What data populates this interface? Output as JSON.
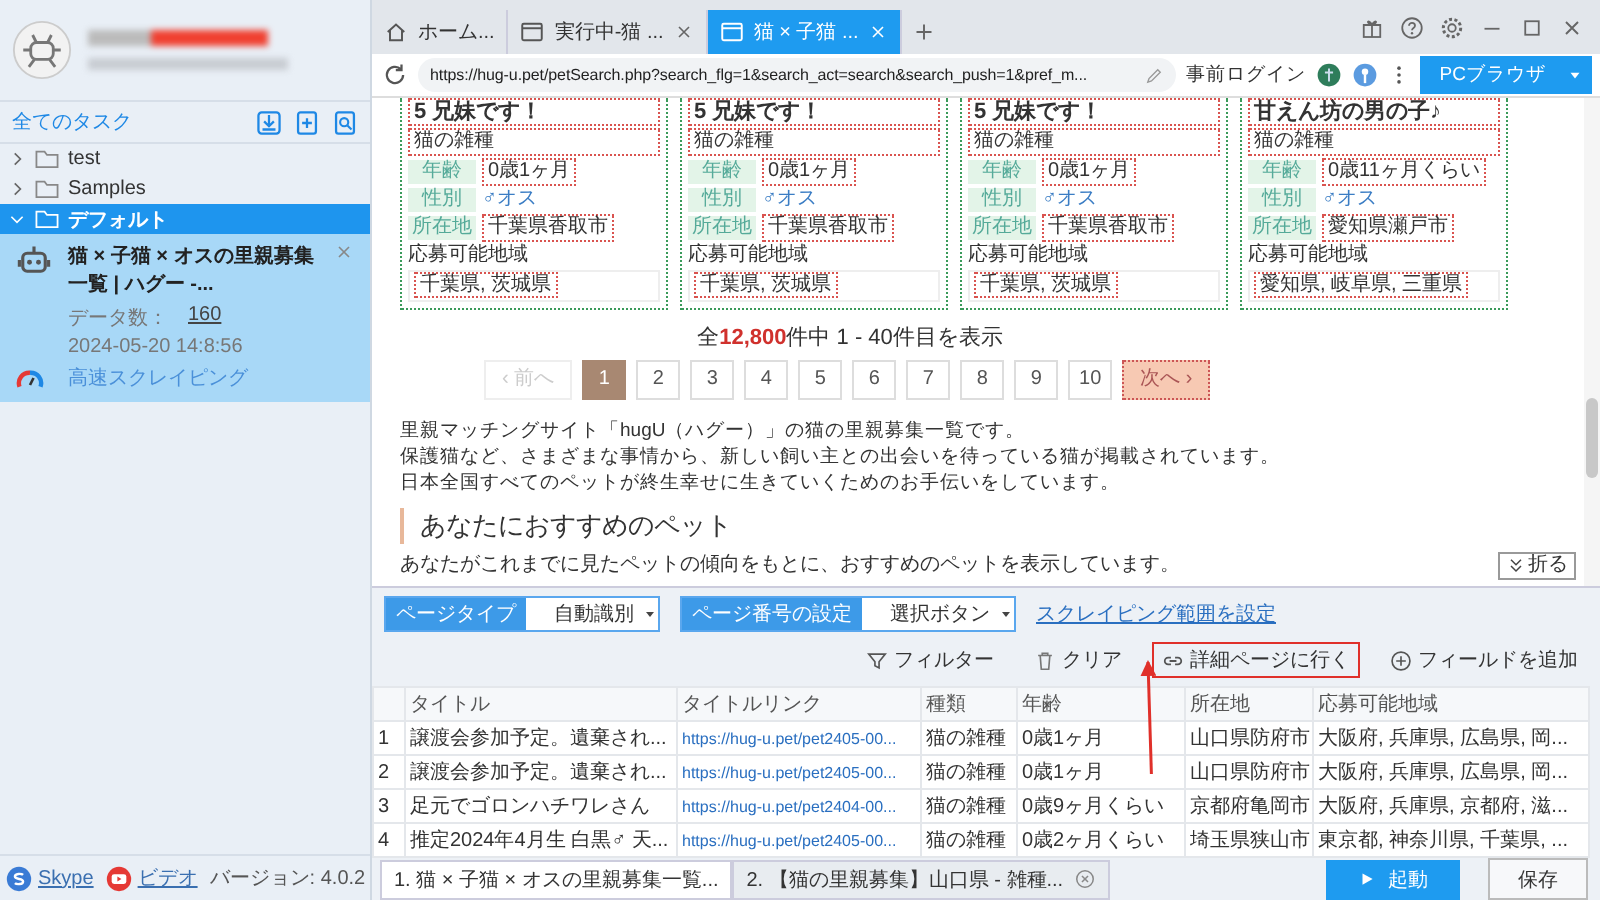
{
  "sidebar": {
    "heading": "全てのタスク",
    "folders": [
      {
        "name": "test",
        "expanded": false,
        "selected": false
      },
      {
        "name": "Samples",
        "expanded": false,
        "selected": false
      },
      {
        "name": "デフォルト",
        "expanded": true,
        "selected": true,
        "tasks": [
          {
            "title": "猫 × 子猫 × オスの里親募集一覧 | ハグー -...",
            "count_label": "データ数：",
            "count": "160",
            "timestamp": "2024-05-20 14:8:56",
            "mode": "高速スクレイピング"
          }
        ]
      }
    ],
    "links": [
      {
        "label": "Skype",
        "kind": "skype"
      },
      {
        "label": "ビデオ",
        "kind": "video"
      }
    ],
    "version": "バージョン: 4.0.2"
  },
  "browser": {
    "tabs": [
      {
        "label": "ホーム...",
        "kind": "home",
        "selected": false
      },
      {
        "label": "実行中-猫 ...",
        "kind": "page",
        "selected": false
      },
      {
        "label": "猫 × 子猫 ...",
        "kind": "page",
        "selected": true
      }
    ],
    "url": "https://hug-u.pet/petSearch.php?search_flg=1&search_act=search&search_push=1&pref_m...",
    "login_button": "事前ログイン",
    "mode_button": "PCブラウザ"
  },
  "page": {
    "cards": [
      {
        "title": "5 兄妹です！",
        "breed": "猫の雑種",
        "fields": [
          {
            "label": "年齢",
            "value": "0歳1ヶ月",
            "kind": "text"
          },
          {
            "label": "性別",
            "value": "♂オス",
            "kind": "gender"
          },
          {
            "label": "所在地",
            "value": "千葉県香取市",
            "kind": "text"
          }
        ],
        "area_label": "応募可能地域",
        "areas": "千葉県, 茨城県"
      },
      {
        "title": "5 兄妹です！",
        "breed": "猫の雑種",
        "fields": [
          {
            "label": "年齢",
            "value": "0歳1ヶ月",
            "kind": "text"
          },
          {
            "label": "性別",
            "value": "♂オス",
            "kind": "gender"
          },
          {
            "label": "所在地",
            "value": "千葉県香取市",
            "kind": "text"
          }
        ],
        "area_label": "応募可能地域",
        "areas": "千葉県, 茨城県"
      },
      {
        "title": "5 兄妹です！",
        "breed": "猫の雑種",
        "fields": [
          {
            "label": "年齢",
            "value": "0歳1ヶ月",
            "kind": "text"
          },
          {
            "label": "性別",
            "value": "♂オス",
            "kind": "gender"
          },
          {
            "label": "所在地",
            "value": "千葉県香取市",
            "kind": "text"
          }
        ],
        "area_label": "応募可能地域",
        "areas": "千葉県, 茨城県"
      },
      {
        "title": "甘えん坊の男の子♪",
        "breed": "猫の雑種",
        "fields": [
          {
            "label": "年齢",
            "value": "0歳11ヶ月くらい",
            "kind": "text"
          },
          {
            "label": "性別",
            "value": "♂オス",
            "kind": "gender"
          },
          {
            "label": "所在地",
            "value": "愛知県瀬戸市",
            "kind": "text"
          }
        ],
        "area_label": "応募可能地域",
        "areas": "愛知県, 岐阜県, 三重県"
      }
    ],
    "summary": {
      "before": "全",
      "count": "12,800",
      "after": "件中 1 - 40件目を表示"
    },
    "pagination": {
      "prev": {
        "label": "‹ 前へ",
        "disabled": true
      },
      "pages": [
        {
          "label": "1",
          "selected": true
        },
        {
          "label": "2",
          "selected": false
        },
        {
          "label": "3",
          "selected": false
        },
        {
          "label": "4",
          "selected": false
        },
        {
          "label": "5",
          "selected": false
        },
        {
          "label": "6",
          "selected": false
        },
        {
          "label": "7",
          "selected": false
        },
        {
          "label": "8",
          "selected": false
        },
        {
          "label": "9",
          "selected": false
        },
        {
          "label": "10",
          "selected": false
        }
      ],
      "next": {
        "label": "次へ ›",
        "disabled": false
      }
    },
    "description": [
      "里親マッチングサイト「hugU（ハグー）」の猫の里親募集一覧です。",
      "保護猫など、さまざまな事情から、新しい飼い主との出会いを待っている猫が掲載されています。",
      "日本全国すべてのペットが終生幸せに生きていくためのお手伝いをしています。"
    ],
    "section": {
      "heading": "あなたにおすすめのペット",
      "text": "あなたがこれまでに見たペットの傾向をもとに、おすすめのペットを表示しています。"
    },
    "fold_button": "折る"
  },
  "panel": {
    "selectors": [
      {
        "label": "ページタイプ",
        "value": "自動識別"
      },
      {
        "label": "ページ番号の設定",
        "value": "選択ボタン"
      }
    ],
    "range_link": "スクレイピング範囲を設定",
    "actions": [
      {
        "label": "フィルター",
        "kind": "filter",
        "highlighted": false
      },
      {
        "label": "クリア",
        "kind": "clear",
        "highlighted": false
      },
      {
        "label": "詳細ページに行く",
        "kind": "link",
        "highlighted": true
      },
      {
        "label": "フィールドを追加",
        "kind": "add",
        "highlighted": false
      }
    ],
    "table": {
      "columns": [
        "",
        "タイトル",
        "タイトルリンク",
        "種類",
        "年齢",
        "所在地",
        "応募可能地域"
      ],
      "rows": [
        [
          "1",
          "譲渡会参加予定。遺棄され...",
          "https://hug-u.pet/pet2405-00...",
          "猫の雑種",
          "0歳1ヶ月",
          "山口県防府市",
          "大阪府, 兵庫県, 広島県, 岡..."
        ],
        [
          "2",
          "譲渡会参加予定。遺棄され...",
          "https://hug-u.pet/pet2405-00...",
          "猫の雑種",
          "0歳1ヶ月",
          "山口県防府市",
          "大阪府, 兵庫県, 広島県, 岡..."
        ],
        [
          "3",
          "足元でゴロンハチワレさん",
          "https://hug-u.pet/pet2404-00...",
          "猫の雑種",
          "0歳9ヶ月くらい",
          "京都府亀岡市",
          "大阪府, 兵庫県, 京都府, 滋..."
        ],
        [
          "4",
          "推定2024年4月生 白黒♂ 天...",
          "https://hug-u.pet/pet2405-00...",
          "猫の雑種",
          "0歳2ヶ月くらい",
          "埼玉県狭山市",
          "東京都, 神奈川県, 千葉県, ..."
        ]
      ]
    },
    "tabs": [
      {
        "label": "1. 猫 × 子猫 × オスの里親募集一覧...",
        "selected": true,
        "closable": false
      },
      {
        "label": "2. 【猫の里親募集】山口県 - 雑種...",
        "selected": false,
        "closable": true
      }
    ],
    "start_button": "起動",
    "save_button": "保存"
  }
}
